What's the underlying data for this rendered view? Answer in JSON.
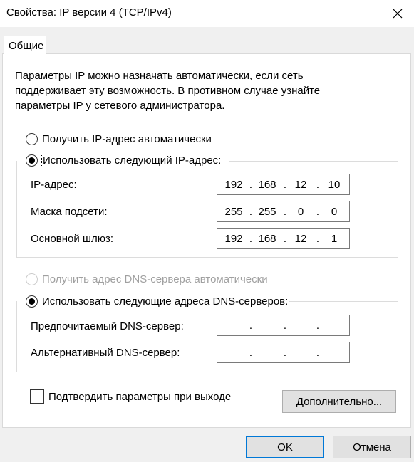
{
  "window": {
    "title": "Свойства: IP версии 4 (TCP/IPv4)",
    "close_icon": "close-icon"
  },
  "tabs": [
    {
      "label": "Общие",
      "active": true
    }
  ],
  "description": "Параметры IP можно назначать автоматически, если сеть поддерживает эту возможность. В противном случае узнайте параметры IP у сетевого администратора.",
  "ip_section": {
    "auto_option": {
      "label": "Получить IP-адрес автоматически",
      "selected": false
    },
    "manual_option": {
      "label": "Использовать следующий IP-адрес:",
      "selected": true
    },
    "fields": [
      {
        "label": "IP-адрес:",
        "octets": [
          "192",
          "168",
          "12",
          "10"
        ]
      },
      {
        "label": "Маска подсети:",
        "octets": [
          "255",
          "255",
          "0",
          "0"
        ]
      },
      {
        "label": "Основной шлюз:",
        "octets": [
          "192",
          "168",
          "12",
          "1"
        ]
      }
    ]
  },
  "dns_section": {
    "auto_option": {
      "label": "Получить адрес DNS-сервера автоматически",
      "selected": false,
      "enabled": false
    },
    "manual_option": {
      "label": "Использовать следующие адреса DNS-серверов:",
      "selected": true
    },
    "fields": [
      {
        "label": "Предпочитаемый DNS-сервер:",
        "octets": [
          "",
          "",
          "",
          ""
        ]
      },
      {
        "label": "Альтернативный DNS-сервер:",
        "octets": [
          "",
          "",
          "",
          ""
        ]
      }
    ]
  },
  "validate_checkbox": {
    "label": "Подтвердить параметры при выходе",
    "checked": false
  },
  "buttons": {
    "advanced": "Дополнительно...",
    "ok": "OK",
    "cancel": "Отмена"
  },
  "colors": {
    "accent": "#0078d7",
    "panel": "#ffffff",
    "window": "#f0f0f0"
  }
}
